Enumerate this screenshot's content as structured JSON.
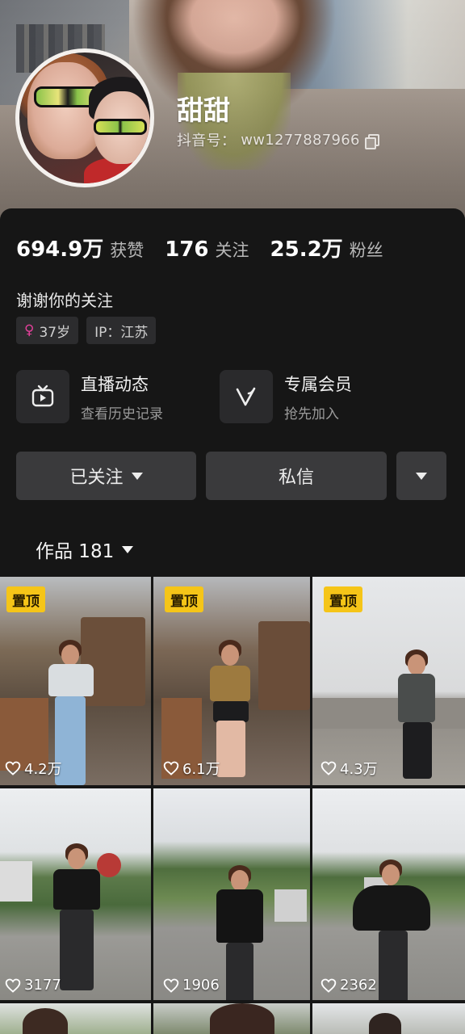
{
  "profile": {
    "nickname": "甜甜",
    "douyin_id_label": "抖音号：",
    "douyin_id": "ww1277887966"
  },
  "stats": [
    {
      "value": "694.9万",
      "label": "获赞"
    },
    {
      "value": "176",
      "label": "关注"
    },
    {
      "value": "25.2万",
      "label": "粉丝"
    }
  ],
  "bio": "谢谢你的关注",
  "tags": {
    "age": "37岁",
    "ip": "IP：江苏"
  },
  "features": [
    {
      "title": "直播动态",
      "subtitle": "查看历史记录",
      "icon": "tv-icon"
    },
    {
      "title": "专属会员",
      "subtitle": "抢先加入",
      "icon": "v-icon"
    }
  ],
  "actions": {
    "follow": "已关注",
    "message": "私信"
  },
  "works": {
    "label": "作品 181"
  },
  "videos": [
    {
      "pinned": "置顶",
      "likes": "4.2万"
    },
    {
      "pinned": "置顶",
      "likes": "6.1万"
    },
    {
      "pinned": "置顶",
      "likes": "4.3万"
    },
    {
      "pinned": "",
      "likes": "3177"
    },
    {
      "pinned": "",
      "likes": "1906"
    },
    {
      "pinned": "",
      "likes": "2362"
    }
  ],
  "colors": {
    "background": "#161616",
    "button": "#3a3a3c",
    "pin_badge": "#f5c518",
    "female": "#e2409a"
  }
}
